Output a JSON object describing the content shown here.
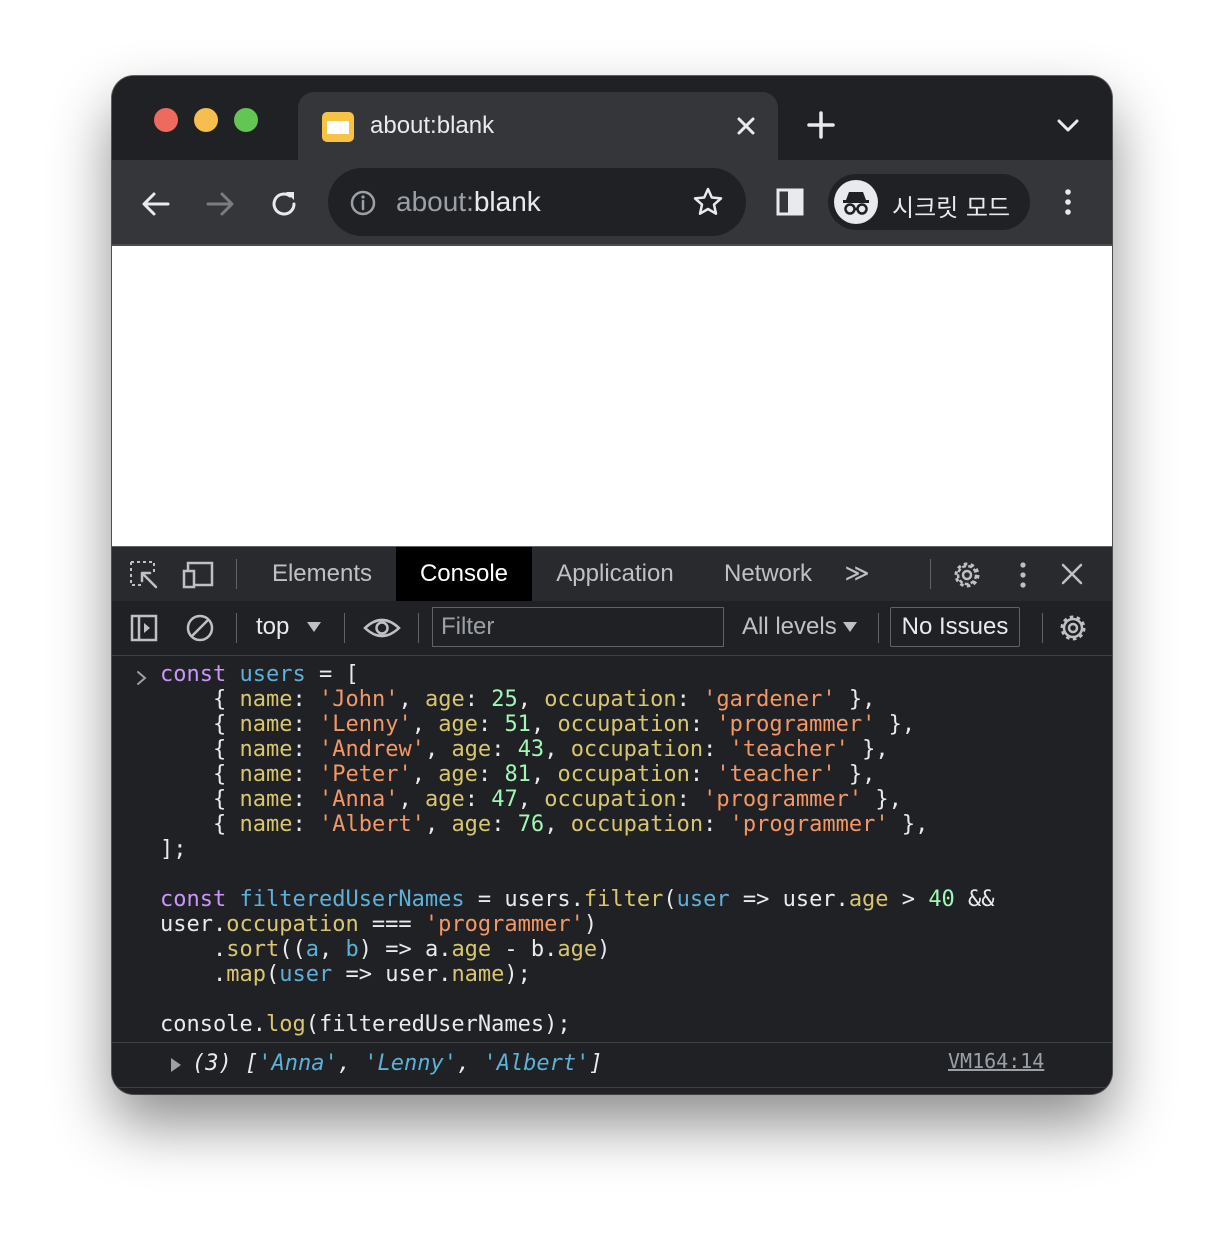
{
  "tab": {
    "title": "about:blank",
    "close_icon": "close-icon",
    "favicon": "page-favicon"
  },
  "toolbar": {
    "url_prefix": "about:",
    "url_host": "blank",
    "incognito_label": "시크릿 모드",
    "icons": [
      "back-icon",
      "forward-icon",
      "reload-icon",
      "info-icon",
      "star-icon",
      "side-panel-icon",
      "incognito-icon",
      "more-icon"
    ]
  },
  "devtools": {
    "tabs": [
      "Elements",
      "Console",
      "Application",
      "Network"
    ],
    "active_tab": "Console",
    "more_tabs": "≫",
    "context": "top",
    "filter_placeholder": "Filter",
    "levels": "All levels",
    "issues": "No Issues"
  },
  "console": {
    "result_count": "(3)",
    "result_items": [
      "'Anna'",
      "'Lenny'",
      "'Albert'"
    ],
    "source_link": "VM164:14"
  },
  "colors": {
    "chrome_dark": "#202124",
    "toolbar": "#35363a",
    "keyword": "#c995f9",
    "string": "#f29766",
    "number": "#a1f7b5",
    "method": "#d8c66f",
    "variable": "#5db0d7"
  }
}
